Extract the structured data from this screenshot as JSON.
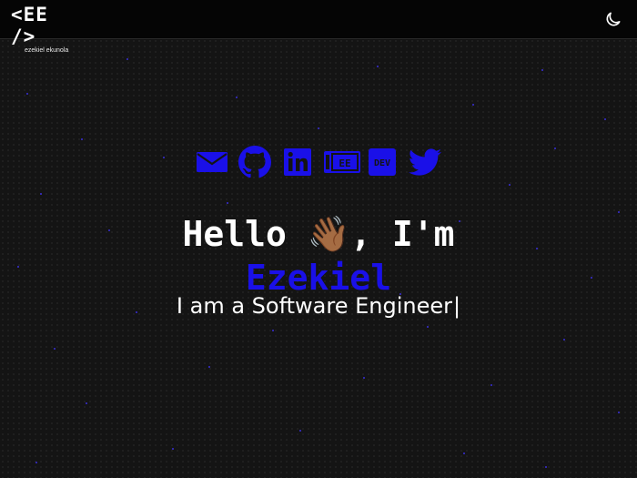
{
  "header": {
    "logo_mark": "<EE />",
    "logo_subtitle": "ezekiel ekunola",
    "theme_icon": "moon-icon"
  },
  "social_links": [
    {
      "name": "mail-icon"
    },
    {
      "name": "github-icon"
    },
    {
      "name": "linkedin-icon"
    },
    {
      "name": "blog-icon",
      "text": "EE"
    },
    {
      "name": "dev-icon",
      "text": "DEV"
    },
    {
      "name": "twitter-icon"
    }
  ],
  "hero": {
    "greeting": "Hello 👋🏾, I'm",
    "name": "Ezekiel",
    "tagline": "I am a Software Engineer",
    "cursor": "|"
  },
  "colors": {
    "accent": "#1a10e8",
    "background": "#141414",
    "header": "#050505",
    "text": "#ffffff"
  }
}
